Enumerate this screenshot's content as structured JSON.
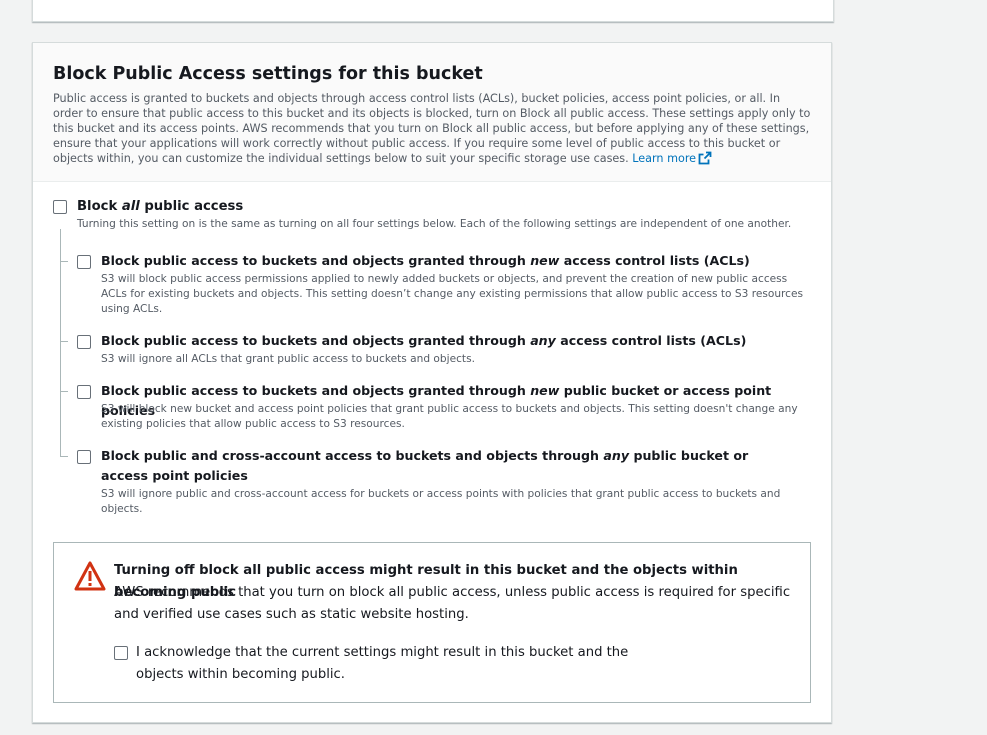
{
  "card": {
    "title": "Block Public Access settings for this bucket",
    "description": "Public access is granted to buckets and objects through access control lists (ACLs), bucket policies, access point policies, or all. In order to ensure that public access to this bucket and its objects is blocked, turn on Block all public access. These settings apply only to this bucket and its access points. AWS recommends that you turn on Block all public access, but before applying any of these settings, ensure that your applications will work correctly without public access. If you require some level of public access to this bucket or objects within, you can customize the individual settings below to suit your specific storage use cases.",
    "learn_more": "Learn more"
  },
  "block_all": {
    "label_pre": "Block ",
    "label_em": "all",
    "label_post": " public access",
    "description": "Turning this setting on is the same as turning on all four settings below. Each of the following settings are independent of one another.",
    "checked": false
  },
  "options": [
    {
      "label_pre": "Block public access to buckets and objects granted through ",
      "label_em": "new",
      "label_post": " access control lists (ACLs)",
      "description": "S3 will block public access permissions applied to newly added buckets or objects, and prevent the creation of new public access ACLs for existing buckets and objects. This setting doesn’t change any existing permissions that allow public access to S3 resources using ACLs.",
      "checked": false
    },
    {
      "label_pre": "Block public access to buckets and objects granted through ",
      "label_em": "any",
      "label_post": " access control lists (ACLs)",
      "description": "S3 will ignore all ACLs that grant public access to buckets and objects.",
      "checked": false
    },
    {
      "label_pre": "Block public access to buckets and objects granted through ",
      "label_em": "new",
      "label_post": " public bucket or access point policies",
      "description": "S3 will block new bucket and access point policies that grant public access to buckets and objects. This setting doesn't change any existing policies that allow public access to S3 resources.",
      "checked": false
    },
    {
      "label_pre": "Block public and cross-account access to buckets and objects through ",
      "label_em": "any",
      "label_post": " public bucket or access point policies",
      "description": "S3 will ignore public and cross-account access for buckets or access points with policies that grant public access to buckets and objects.",
      "checked": false
    }
  ],
  "warning": {
    "title": "Turning off block all public access might result in this bucket and the objects within becoming public",
    "text": "AWS recommends that you turn on block all public access, unless public access is required for specific and verified use cases such as static website hosting.",
    "acknowledge": "I acknowledge that the current settings might result in this bucket and the objects within becoming public.",
    "acknowledge_checked": false
  },
  "colors": {
    "link": "#0073bb",
    "warning_icon": "#d13212",
    "text": "#16191f",
    "muted": "#545b64"
  }
}
